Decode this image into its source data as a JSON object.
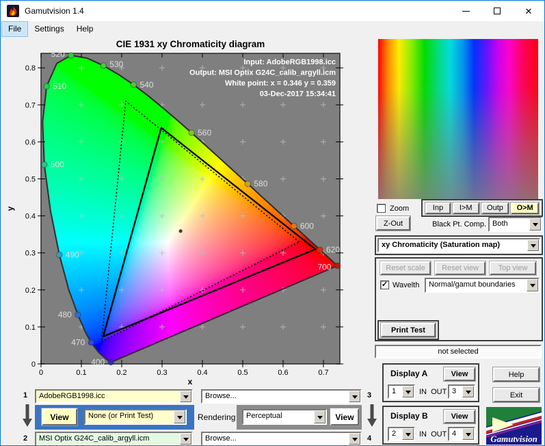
{
  "window": {
    "title": "Gamutvision 1.4"
  },
  "menu": {
    "items": [
      "File",
      "Settings",
      "Help"
    ],
    "highlighted": "File"
  },
  "chart_data": {
    "type": "scatter",
    "description": "CIE 1931 xy chromaticity diagram with spectral locus, input and output gamut triangles over a chromaticity color fill; gray outside the locus",
    "title": "CIE 1931 xy Chromaticity diagram",
    "xlabel": "x",
    "ylabel": "y",
    "xlim": [
      0,
      0.74
    ],
    "ylim": [
      0,
      0.84
    ],
    "xticks": [
      0,
      0.1,
      0.2,
      0.3,
      0.4,
      0.5,
      0.6,
      0.7
    ],
    "yticks": [
      0,
      0.1,
      0.2,
      0.3,
      0.4,
      0.5,
      0.6,
      0.7,
      0.8
    ],
    "grid_step": 0.1,
    "plot_bg_outside_locus": "#7f7f7f",
    "annotations": [
      "Input:  AdobeRGB1998.icc",
      "Output: MSI Optix G24C_calib_argyll.icm",
      "White point:  x = 0.346  y = 0.359",
      "03-Dec-2017 15:34:41"
    ],
    "white_point": {
      "x": 0.346,
      "y": 0.359
    },
    "input_gamut": {
      "name": "AdobeRGB1998.icc",
      "style": "dotted",
      "vertices": [
        [
          0.64,
          0.33
        ],
        [
          0.21,
          0.71
        ],
        [
          0.15,
          0.06
        ]
      ]
    },
    "output_gamut": {
      "name": "MSI Optix G24C_calib_argyll.icm",
      "style": "solid",
      "vertices": [
        [
          0.68,
          0.31
        ],
        [
          0.298,
          0.638
        ],
        [
          0.154,
          0.074
        ]
      ]
    },
    "wavelength_markers": [
      {
        "wl": "400",
        "x": 0.1733,
        "y": 0.0048,
        "color": "#3a23c0",
        "side": "left"
      },
      {
        "wl": "470",
        "x": 0.1241,
        "y": 0.0578,
        "color": "#3348dd",
        "side": "left"
      },
      {
        "wl": "480",
        "x": 0.0913,
        "y": 0.1327,
        "color": "#2f6fd0",
        "side": "left"
      },
      {
        "wl": "490",
        "x": 0.0454,
        "y": 0.295,
        "color": "#2f9fc0",
        "side": "right"
      },
      {
        "wl": "500",
        "x": 0.0082,
        "y": 0.5384,
        "color": "#25c97c",
        "side": "right"
      },
      {
        "wl": "510",
        "x": 0.0139,
        "y": 0.7502,
        "color": "#20cf56",
        "side": "right"
      },
      {
        "wl": "520",
        "x": 0.0743,
        "y": 0.8338,
        "color": "#2fcf3f",
        "side": "left",
        "dy": -2
      },
      {
        "wl": "530",
        "x": 0.1547,
        "y": 0.8059,
        "color": "#3ecf3a",
        "side": "right",
        "dy": -2
      },
      {
        "wl": "540",
        "x": 0.2296,
        "y": 0.7543,
        "color": "#52c832",
        "side": "right"
      },
      {
        "wl": "560",
        "x": 0.3731,
        "y": 0.6245,
        "color": "#7dc52a",
        "side": "right"
      },
      {
        "wl": "580",
        "x": 0.5125,
        "y": 0.4866,
        "color": "#c7a322",
        "side": "right"
      },
      {
        "wl": "600",
        "x": 0.627,
        "y": 0.3725,
        "color": "#e07818",
        "side": "right"
      },
      {
        "wl": "620",
        "x": 0.6915,
        "y": 0.3083,
        "color": "#d03414",
        "side": "right"
      },
      {
        "wl": "700",
        "x": 0.7347,
        "y": 0.2653,
        "color": "#c01616",
        "side": "left",
        "dy": 2
      }
    ],
    "spectral_locus": [
      [
        380,
        0.1741,
        0.005
      ],
      [
        390,
        0.1738,
        0.0049
      ],
      [
        400,
        0.1733,
        0.0048
      ],
      [
        410,
        0.1726,
        0.0048
      ],
      [
        420,
        0.1714,
        0.0051
      ],
      [
        430,
        0.1689,
        0.0069
      ],
      [
        440,
        0.1644,
        0.0109
      ],
      [
        450,
        0.1566,
        0.0177
      ],
      [
        460,
        0.144,
        0.0297
      ],
      [
        470,
        0.1241,
        0.0578
      ],
      [
        475,
        0.1096,
        0.0868
      ],
      [
        480,
        0.0913,
        0.1327
      ],
      [
        485,
        0.0687,
        0.2007
      ],
      [
        490,
        0.0454,
        0.295
      ],
      [
        495,
        0.0235,
        0.4127
      ],
      [
        500,
        0.0082,
        0.5384
      ],
      [
        505,
        0.0039,
        0.6548
      ],
      [
        510,
        0.0139,
        0.7502
      ],
      [
        515,
        0.0389,
        0.812
      ],
      [
        520,
        0.0743,
        0.8338
      ],
      [
        525,
        0.1142,
        0.8262
      ],
      [
        530,
        0.1547,
        0.8059
      ],
      [
        535,
        0.1929,
        0.7816
      ],
      [
        540,
        0.2296,
        0.7543
      ],
      [
        545,
        0.2658,
        0.7243
      ],
      [
        550,
        0.3016,
        0.6923
      ],
      [
        555,
        0.3373,
        0.6589
      ],
      [
        560,
        0.3731,
        0.6245
      ],
      [
        565,
        0.4087,
        0.5896
      ],
      [
        570,
        0.4441,
        0.5547
      ],
      [
        575,
        0.4788,
        0.5202
      ],
      [
        580,
        0.5125,
        0.4866
      ],
      [
        585,
        0.5448,
        0.4544
      ],
      [
        590,
        0.5752,
        0.4242
      ],
      [
        595,
        0.6029,
        0.3965
      ],
      [
        600,
        0.627,
        0.3725
      ],
      [
        605,
        0.6482,
        0.3514
      ],
      [
        610,
        0.6658,
        0.334
      ],
      [
        615,
        0.6801,
        0.3197
      ],
      [
        620,
        0.6915,
        0.3083
      ],
      [
        630,
        0.7079,
        0.292
      ],
      [
        640,
        0.719,
        0.2809
      ],
      [
        650,
        0.726,
        0.274
      ],
      [
        660,
        0.73,
        0.27
      ],
      [
        680,
        0.7334,
        0.2666
      ],
      [
        700,
        0.7347,
        0.2653
      ]
    ]
  },
  "right_panel": {
    "zoom_label": "Zoom",
    "map_buttons": [
      {
        "label": "Inp"
      },
      {
        "label": "I>M"
      },
      {
        "label": "Outp"
      },
      {
        "label": "O>M",
        "active": true
      }
    ],
    "zout_label": "Z-Out",
    "black_pt_label": "Black Pt. Comp.",
    "black_pt_value": "Both",
    "display_mode": "xy Chromaticity (Saturation map)",
    "reset_buttons": [
      "Reset scale",
      "Reset view",
      "Top view"
    ],
    "wavelth_label": "Wavelth",
    "boundaries_value": "Normal/gamut boundaries",
    "print_test_label": "Print Test",
    "status": "not selected",
    "display_a": {
      "title": "Display A",
      "view": "View",
      "in": "1",
      "inout": "IN  OUT",
      "out": "3"
    },
    "display_b": {
      "title": "Display B",
      "view": "View",
      "in": "2",
      "inout": "IN  OUT",
      "out": "4"
    },
    "help_label": "Help",
    "exit_label": "Exit",
    "logo_text": "Gamutvision"
  },
  "bottom_panel": {
    "slot1": {
      "index": "1",
      "value": "AdobeRGB1998.icc",
      "browse": "Browse...",
      "out_index": "3"
    },
    "slot2": {
      "index": "2",
      "value": "MSI Optix G24C_calib_argyll.icm",
      "browse": "Browse...",
      "out_index": "4"
    },
    "view_input_label": "View",
    "simulation_value": "None (or Print Test)",
    "rendering_label": "Rendering",
    "rendering_value": "Perceptual",
    "view_output_label": "View"
  },
  "colors": {
    "window_border": "#0078d7",
    "titlebar_bg": "#ffffff",
    "client_bg": "#f0f0f0",
    "plot_gray": "#7f7f7f",
    "panel_blue": "#3c74c0",
    "panel_gray": "#8b8b8b",
    "button_yellow": "#ffffc4",
    "field_yellow": "#ffffcc",
    "field_green": "#e2f9e2",
    "logo_navy": "#1a1a8c"
  }
}
